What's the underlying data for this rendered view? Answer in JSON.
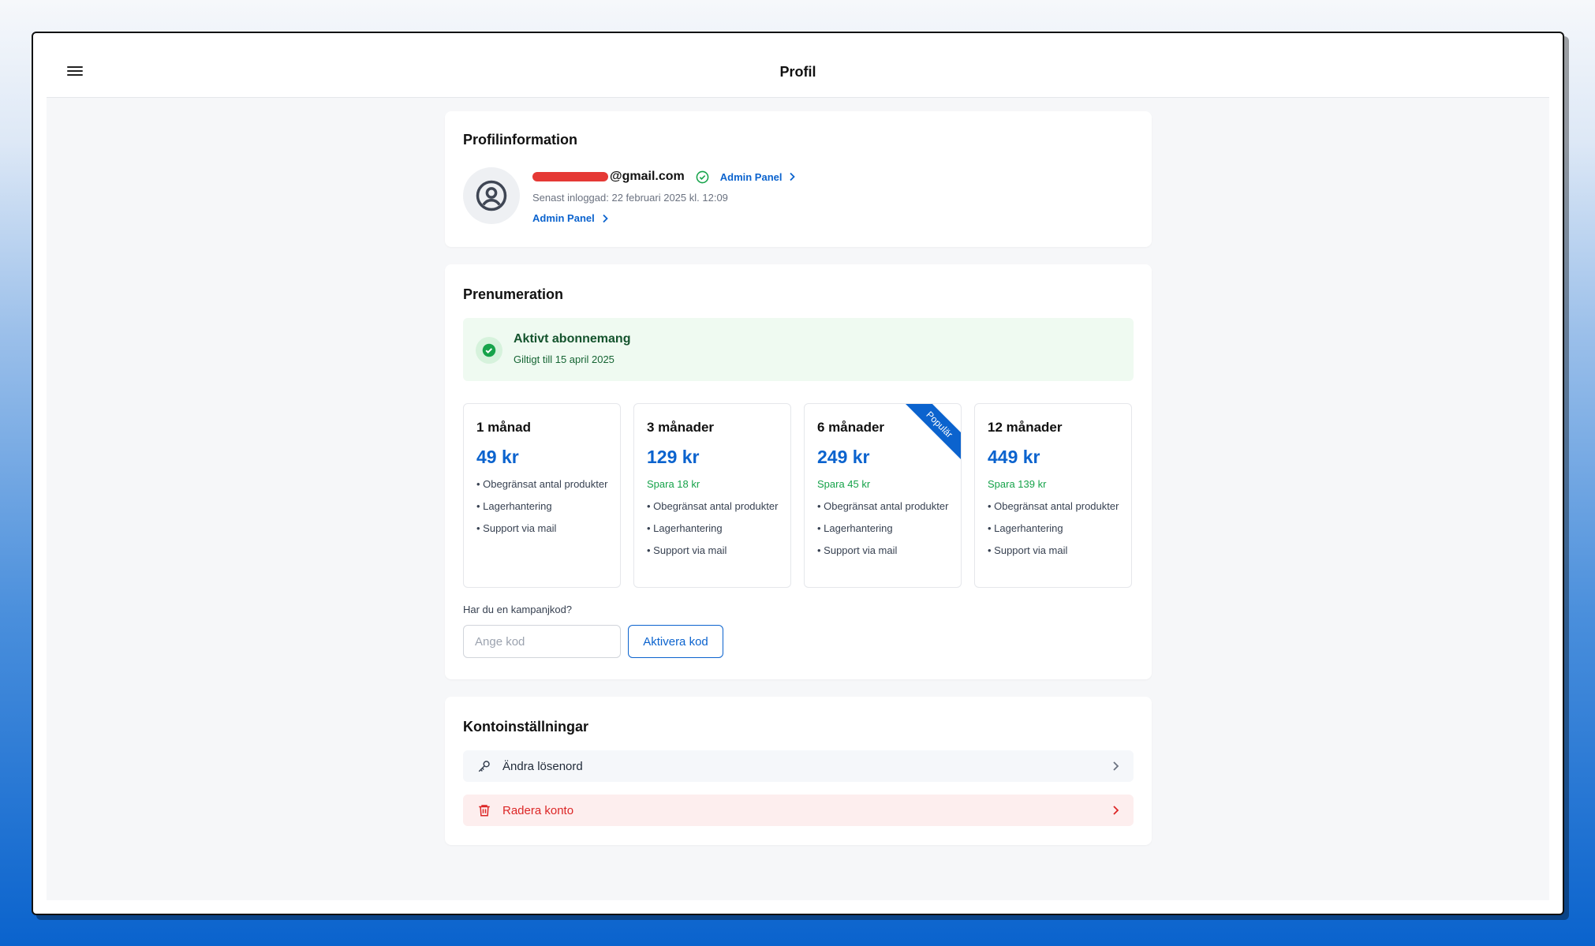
{
  "header": {
    "title": "Profil",
    "menu_icon": "hamburger-menu-icon"
  },
  "profile": {
    "section_title": "Profilinformation",
    "avatar_icon": "user-circle-icon",
    "email_suffix": "@gmail.com",
    "verified_icon": "check-circle-icon",
    "admin_panel_label": "Admin Panel",
    "last_login": "Senast inloggad: 22 februari 2025 kl. 12:09",
    "admin_panel_label_2": "Admin Panel"
  },
  "subscription": {
    "section_title": "Prenumeration",
    "status_title": "Aktivt abonnemang",
    "status_sub": "Giltigt till 15 april 2025",
    "plans": [
      {
        "name": "1 månad",
        "price": "49 kr",
        "save": "",
        "features": [
          "Obegränsat antal produkter",
          "Lagerhantering",
          "Support via mail"
        ]
      },
      {
        "name": "3 månader",
        "price": "129 kr",
        "save": "Spara 18 kr",
        "features": [
          "Obegränsat antal produkter",
          "Lagerhantering",
          "Support via mail"
        ]
      },
      {
        "name": "6 månader",
        "price": "249 kr",
        "save": "Spara 45 kr",
        "badge": "Populär",
        "features": [
          "Obegränsat antal produkter",
          "Lagerhantering",
          "Support via mail"
        ]
      },
      {
        "name": "12 månader",
        "price": "449 kr",
        "save": "Spara 139 kr",
        "features": [
          "Obegränsat antal produkter",
          "Lagerhantering",
          "Support via mail"
        ]
      }
    ],
    "promo_label": "Har du en kampanjkod?",
    "promo_placeholder": "Ange kod",
    "promo_value": "",
    "promo_button": "Aktivera kod"
  },
  "settings": {
    "section_title": "Kontoinställningar",
    "change_password": "Ändra lösenord",
    "delete_account": "Radera konto"
  },
  "colors": {
    "accent": "#0b63ce",
    "success": "#16a34a",
    "danger": "#dc2626"
  }
}
